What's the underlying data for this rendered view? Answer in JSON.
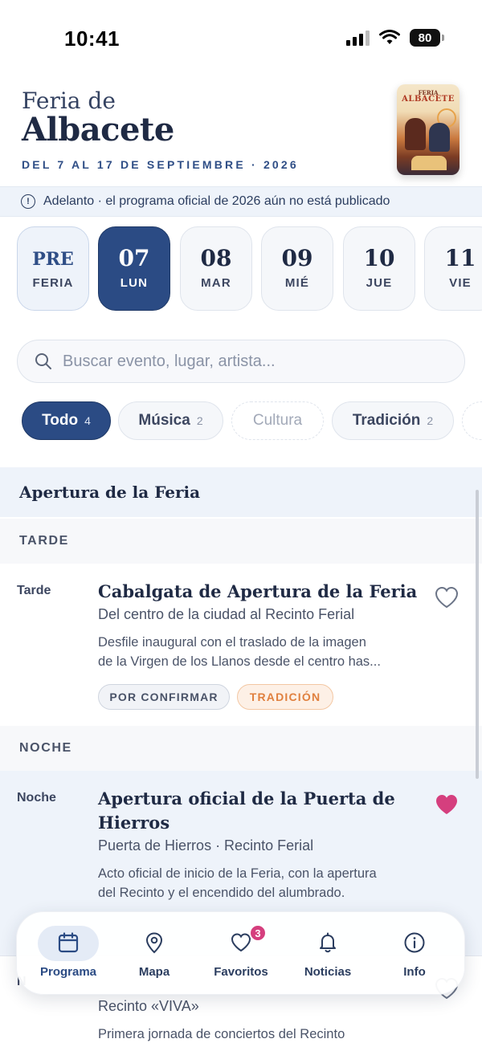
{
  "status_bar": {
    "time": "10:41",
    "battery": "80"
  },
  "header": {
    "title_small": "Feria de",
    "title_large": "Albacete",
    "dates": "DEL 7 AL 17 DE SEPTIEMBRE · 2026",
    "poster": {
      "line1": "FERIA",
      "line2": "ALBACETE"
    }
  },
  "notice": {
    "text": "Adelanto · el programa oficial de 2026 aún no está publicado"
  },
  "days": [
    {
      "num": "PRE",
      "label": "FERIA",
      "state": "pre"
    },
    {
      "num": "07",
      "label": "LUN",
      "state": "active"
    },
    {
      "num": "08",
      "label": "MAR",
      "state": ""
    },
    {
      "num": "09",
      "label": "MIÉ",
      "state": ""
    },
    {
      "num": "10",
      "label": "JUE",
      "state": ""
    },
    {
      "num": "11",
      "label": "VIE",
      "state": ""
    }
  ],
  "search": {
    "placeholder": "Buscar evento, lugar, artista..."
  },
  "filters": [
    {
      "label": "Todo",
      "count": "4",
      "state": "active"
    },
    {
      "label": "Música",
      "count": "2",
      "state": ""
    },
    {
      "label": "Cultura",
      "count": "",
      "state": "dashed"
    },
    {
      "label": "Tradición",
      "count": "2",
      "state": ""
    }
  ],
  "program": {
    "section_title": "Apertura de la Feria",
    "groups": [
      {
        "label": "TARDE",
        "event": {
          "time": "Tarde",
          "title": "Cabalgata de Apertura de la Feria",
          "place": "Del centro de la ciudad al Recinto Ferial",
          "desc_line1": "Desfile inaugural con el traslado de la imagen",
          "desc_line2": "de la Virgen de los Llanos desde el centro has...",
          "tags": [
            "POR CONFIRMAR",
            "TRADICIÓN"
          ],
          "favorite": false
        }
      },
      {
        "label": "NOCHE",
        "event": {
          "time": "Noche",
          "title_line1": "Apertura oficial de la Puerta de",
          "title_line2": "Hierros",
          "place": "Puerta de Hierros · Recinto Ferial",
          "desc_line1": "Acto oficial de inicio de la Feria, con la apertura",
          "desc_line2": "del Recinto y el encendido del alumbrado.",
          "favorite": true
        }
      }
    ],
    "partial_event": {
      "time": "N",
      "place": "Recinto «VIVA»",
      "desc": "Primera jornada de conciertos del Recinto"
    }
  },
  "tabbar": {
    "tabs": [
      {
        "label": "Programa",
        "icon": "calendar-icon",
        "active": true
      },
      {
        "label": "Mapa",
        "icon": "map-pin-icon",
        "active": false
      },
      {
        "label": "Favoritos",
        "icon": "heart-icon",
        "active": false,
        "badge": "3"
      },
      {
        "label": "Noticias",
        "icon": "bell-icon",
        "active": false
      },
      {
        "label": "Info",
        "icon": "info-icon",
        "active": false
      }
    ]
  },
  "colors": {
    "accent": "#2b4b84",
    "favorite": "#d53f7e",
    "tradicion": "#e0803f"
  }
}
